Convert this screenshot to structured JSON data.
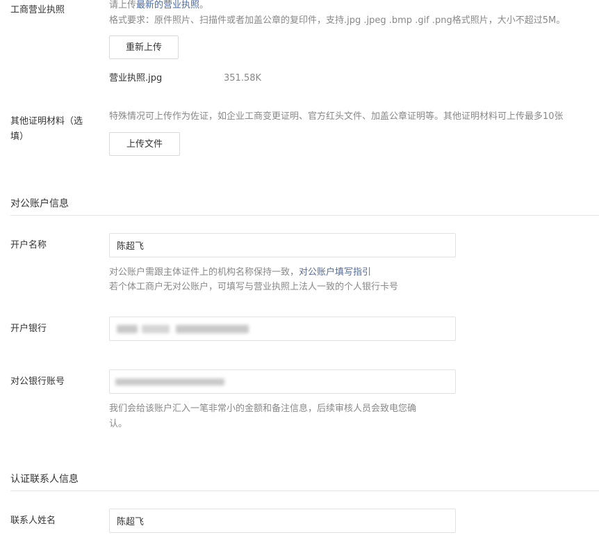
{
  "license": {
    "label": "工商营业执照",
    "hint_prefix": "请上传",
    "hint_link": "最新的营业执照",
    "hint_suffix": "。",
    "format_hint": "格式要求：原件照片、扫描件或者加盖公章的复印件，支持.jpg .jpeg .bmp .gif .png格式照片，大小不超过5M。",
    "reupload_label": "重新上传",
    "file_name": "营业执照.jpg",
    "file_size": "351.58K"
  },
  "other_docs": {
    "label_line1": "其他证明材料（选",
    "label_line2": "填）",
    "hint": "特殊情况可上传作为佐证，如企业工商变更证明、官方红头文件、加盖公章证明等。其他证明材料可上传最多10张",
    "upload_label": "上传文件"
  },
  "bank_section": {
    "title": "对公账户信息",
    "account_name_label": "开户名称",
    "account_name_value": "陈超飞",
    "account_name_hint_prefix": "对公账户需跟主体证件上的机构名称保持一致，",
    "account_name_hint_link": "对公账户填写指引",
    "account_name_hint_line2": "若个体工商户无对公账户，可填写与营业执照上法人一致的个人银行卡号",
    "bank_label": "开户银行",
    "account_number_label": "对公银行账号",
    "account_number_hint_line1": "我们会给该账户汇入一笔非常小的金额和备注信息，后续审核人员会致电您确",
    "account_number_hint_line2": "认。"
  },
  "contact_section": {
    "title": "认证联系人信息",
    "contact_name_label": "联系人姓名",
    "contact_name_value": "陈超飞"
  }
}
